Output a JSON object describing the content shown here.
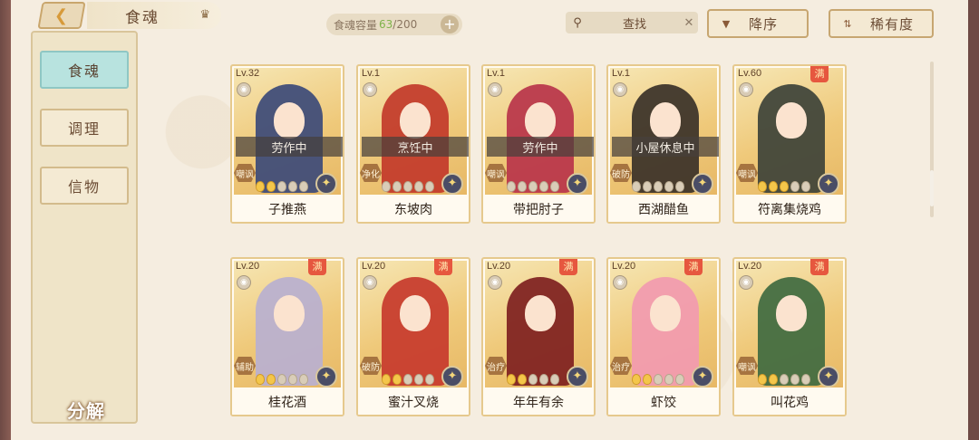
{
  "header": {
    "back_icon": "chevron-left",
    "title": "食魂",
    "capacity_label": "食魂容量",
    "capacity_current": "63",
    "capacity_max": "/200",
    "add_label": "+",
    "search_label": "查找",
    "clear_label": "✕",
    "sort_label": "降序",
    "rarity_label": "稀有度"
  },
  "sidebar": {
    "tabs": [
      {
        "label": "食魂",
        "active": true
      },
      {
        "label": "调理",
        "active": false
      },
      {
        "label": "信物",
        "active": false
      }
    ],
    "decompose_label": "分解"
  },
  "cards": [
    {
      "level": "Lv.32",
      "status": "劳作中",
      "role": "嘲讽",
      "stars": 2,
      "name": "子推燕",
      "max": false,
      "color": "#3c4a78"
    },
    {
      "level": "Lv.1",
      "status": "烹饪中",
      "role": "净化",
      "stars": 0,
      "name": "东坡肉",
      "max": false,
      "color": "#c23a2a"
    },
    {
      "level": "Lv.1",
      "status": "劳作中",
      "role": "嘲讽",
      "stars": 0,
      "name": "带把肘子",
      "max": false,
      "color": "#b8344a"
    },
    {
      "level": "Lv.1",
      "status": "小屋休息中",
      "role": "破防",
      "stars": 0,
      "name": "西湖醋鱼",
      "max": false,
      "color": "#3a3128"
    },
    {
      "level": "Lv.60",
      "status": "",
      "role": "嘲讽",
      "stars": 3,
      "name": "符离集烧鸡",
      "max": true,
      "color": "#3d4238"
    },
    {
      "level": "Lv.20",
      "status": "",
      "role": "辅助",
      "stars": 2,
      "name": "桂花酒",
      "max": true,
      "color": "#b8b0d0"
    },
    {
      "level": "Lv.20",
      "status": "",
      "role": "破防",
      "stars": 2,
      "name": "蜜汁叉烧",
      "max": true,
      "color": "#c73a2c"
    },
    {
      "level": "Lv.20",
      "status": "",
      "role": "治疗",
      "stars": 2,
      "name": "年年有余",
      "max": true,
      "color": "#7e1f1f"
    },
    {
      "level": "Lv.20",
      "status": "",
      "role": "治疗",
      "stars": 2,
      "name": "虾饺",
      "max": true,
      "color": "#f29ab0"
    },
    {
      "level": "Lv.20",
      "status": "",
      "role": "嘲讽",
      "stars": 2,
      "name": "叫花鸡",
      "max": true,
      "color": "#3f6a40"
    }
  ],
  "max_badge": "满",
  "eye_icon": "◉",
  "rarity_icon": "✦"
}
